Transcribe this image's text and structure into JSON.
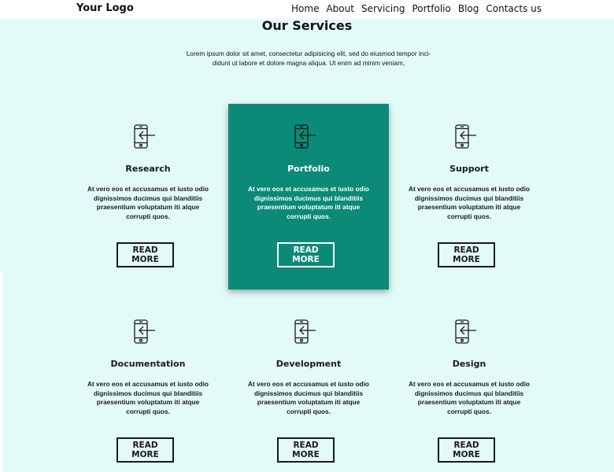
{
  "header": {
    "logo": "Your Logo",
    "nav": [
      "Home",
      "About",
      "Servicing",
      "Portfolio",
      "Blog",
      "Contacts us"
    ]
  },
  "section": {
    "title": "Our Services",
    "subtitle": "Lorem ipsum dolor sit amet, consectetur adipisicing elit, sed do eiusmod tempor inci-didunt ut labore et dolore magna aliqua. Ut enim ad minim veniam,"
  },
  "cards": [
    {
      "title": "Research",
      "text": "At vero eos et accusamus et iusto odio dignissimos ducimus qui blanditiis praesentium voluptatum iti atque corrupti quos.",
      "button": "READ MORE"
    },
    {
      "title": "Portfolio",
      "text": "At vero eos et accusamus et iusto odio dignissimos ducimus qui blanditiis praesentium voluptatum iti atque corrupti quos.",
      "button": "READ MORE"
    },
    {
      "title": "Support",
      "text": "At vero eos et accusamus et iusto odio dignissimos ducimus qui blanditiis praesentium voluptatum iti atque corrupti quos.",
      "button": "READ MORE"
    },
    {
      "title": "Documentation",
      "text": "At vero eos et accusamus et iusto odio dignissimos ducimus qui blanditiis praesentium voluptatum iti atque corrupti quos.",
      "button": "READ MORE"
    },
    {
      "title": "Development",
      "text": "At vero eos et accusamus et iusto odio dignissimos ducimus qui blanditiis praesentium voluptatum iti atque corrupti quos.",
      "button": "READ MORE"
    },
    {
      "title": "Design",
      "text": "At vero eos et accusamus et iusto odio dignissimos ducimus qui blanditiis praesentium voluptatum iti atque corrupti quos.",
      "button": "READ MORE"
    }
  ],
  "icons": {
    "card_icon": "mobile-login-icon"
  },
  "colors": {
    "background": "#e3fbf7",
    "accent": "#0b8a77",
    "navbar": "#ffffff"
  }
}
